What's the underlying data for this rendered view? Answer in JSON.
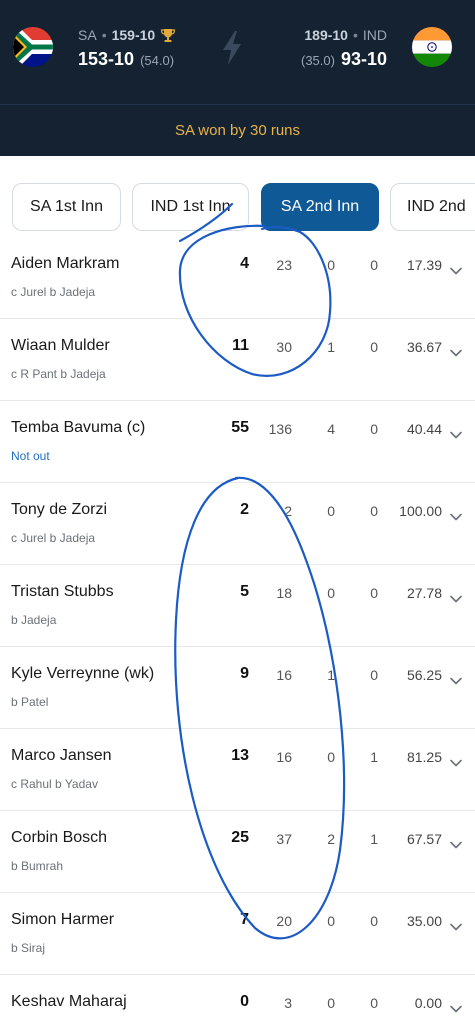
{
  "header": {
    "left_team": {
      "code": "SA",
      "first_innings": "159-10",
      "second_innings": "153-10",
      "overs": "(54.0)",
      "flag": "south-africa-flag",
      "winner_icon": "trophy-icon"
    },
    "right_team": {
      "code": "IND",
      "first_innings": "189-10",
      "second_innings": "93-10",
      "overs": "(35.0)",
      "flag": "india-flag"
    },
    "separator_icon": "lightning-bolt-icon",
    "result": "SA won by 30 runs"
  },
  "tabs": [
    {
      "label": "SA 1st Inn",
      "active": false
    },
    {
      "label": "IND 1st Inn",
      "active": false
    },
    {
      "label": "SA 2nd Inn",
      "active": true
    },
    {
      "label": "IND 2nd",
      "active": false
    }
  ],
  "batters": [
    {
      "name": "Aiden Markram",
      "dismissal": "c Jurel b Jadeja",
      "runs": "4",
      "balls": "23",
      "fours": "0",
      "sixes": "0",
      "sr": "17.39"
    },
    {
      "name": "Wiaan Mulder",
      "dismissal": "c R Pant b Jadeja",
      "runs": "11",
      "balls": "30",
      "fours": "1",
      "sixes": "0",
      "sr": "36.67"
    },
    {
      "name": "Temba Bavuma (c)",
      "dismissal": "Not out",
      "runs": "55",
      "balls": "136",
      "fours": "4",
      "sixes": "0",
      "sr": "40.44"
    },
    {
      "name": "Tony de Zorzi",
      "dismissal": "c Jurel b Jadeja",
      "runs": "2",
      "balls": "2",
      "fours": "0",
      "sixes": "0",
      "sr": "100.00"
    },
    {
      "name": "Tristan Stubbs",
      "dismissal": "b Jadeja",
      "runs": "5",
      "balls": "18",
      "fours": "0",
      "sixes": "0",
      "sr": "27.78"
    },
    {
      "name": "Kyle Verreynne (wk)",
      "dismissal": "b Patel",
      "runs": "9",
      "balls": "16",
      "fours": "1",
      "sixes": "0",
      "sr": "56.25"
    },
    {
      "name": "Marco Jansen",
      "dismissal": "c Rahul b Yadav",
      "runs": "13",
      "balls": "16",
      "fours": "0",
      "sixes": "1",
      "sr": "81.25"
    },
    {
      "name": "Corbin Bosch",
      "dismissal": "b Bumrah",
      "runs": "25",
      "balls": "37",
      "fours": "2",
      "sixes": "1",
      "sr": "67.57"
    },
    {
      "name": "Simon Harmer",
      "dismissal": "b Siraj",
      "runs": "7",
      "balls": "20",
      "fours": "0",
      "sixes": "0",
      "sr": "35.00"
    },
    {
      "name": "Keshav Maharaj",
      "dismissal": "",
      "runs": "0",
      "balls": "3",
      "fours": "0",
      "sixes": "0",
      "sr": "0.00"
    }
  ],
  "colors": {
    "header_bg": "#142232",
    "result": "#e7b24a",
    "active_tab": "#0f5a96",
    "annotation": "#1b5bc4",
    "not_out": "#1f6fbf"
  }
}
